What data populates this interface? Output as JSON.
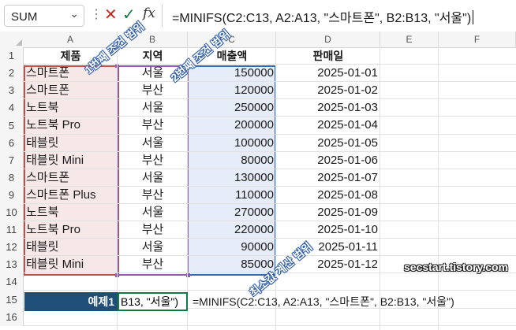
{
  "formula_bar": {
    "name_box": "SUM",
    "formula": "=MINIFS(C2:C13, A2:A13, \"스마트폰\", B2:B13, \"서울\")"
  },
  "columns": [
    "A",
    "B",
    "C",
    "D",
    "E",
    "F"
  ],
  "rows": [
    "1",
    "2",
    "3",
    "4",
    "5",
    "6",
    "7",
    "8",
    "9",
    "10",
    "11",
    "12",
    "13",
    "14",
    "15",
    "16"
  ],
  "table": {
    "headers": [
      "제품",
      "지역",
      "매출액",
      "판매일"
    ],
    "data": [
      [
        "스마트폰",
        "서울",
        "150000",
        "2025-01-01"
      ],
      [
        "스마트폰",
        "부산",
        "120000",
        "2025-01-02"
      ],
      [
        "노트북",
        "서울",
        "250000",
        "2025-01-03"
      ],
      [
        "노트북 Pro",
        "부산",
        "200000",
        "2025-01-04"
      ],
      [
        "태블릿",
        "서울",
        "100000",
        "2025-01-05"
      ],
      [
        "태블릿 Mini",
        "부산",
        "80000",
        "2025-01-06"
      ],
      [
        "스마트폰",
        "서울",
        "130000",
        "2025-01-07"
      ],
      [
        "스마트폰 Plus",
        "부산",
        "110000",
        "2025-01-08"
      ],
      [
        "노트북",
        "서울",
        "270000",
        "2025-01-09"
      ],
      [
        "노트북 Pro",
        "부산",
        "220000",
        "2025-01-10"
      ],
      [
        "태블릿",
        "서울",
        "90000",
        "2025-01-11"
      ],
      [
        "태블릿 Mini",
        "부산",
        "85000",
        "2025-01-12"
      ]
    ]
  },
  "annotations": {
    "range1": "1번째 조건 범위",
    "range2": "2번째 조건 범위",
    "min_range": "최소값 계산 범위"
  },
  "watermark": "secstart.tistory.com",
  "row15": {
    "label": "예제1",
    "editing": "B13, \"서울\")",
    "formula_note": "=MINIFS(C2:C13, A2:A13, \"스마트폰\", B2:B13, \"서울\")"
  },
  "icons": [
    "chevron-down-icon",
    "more-options-icon",
    "cancel-icon",
    "confirm-icon",
    "function-icon"
  ],
  "colors": {
    "range1_border": "#c0504d",
    "range2_border": "#8e5ab5",
    "min_range_border": "#2e6db4",
    "label_fill": "#1f4e79",
    "active_cell_border": "#107c41"
  }
}
